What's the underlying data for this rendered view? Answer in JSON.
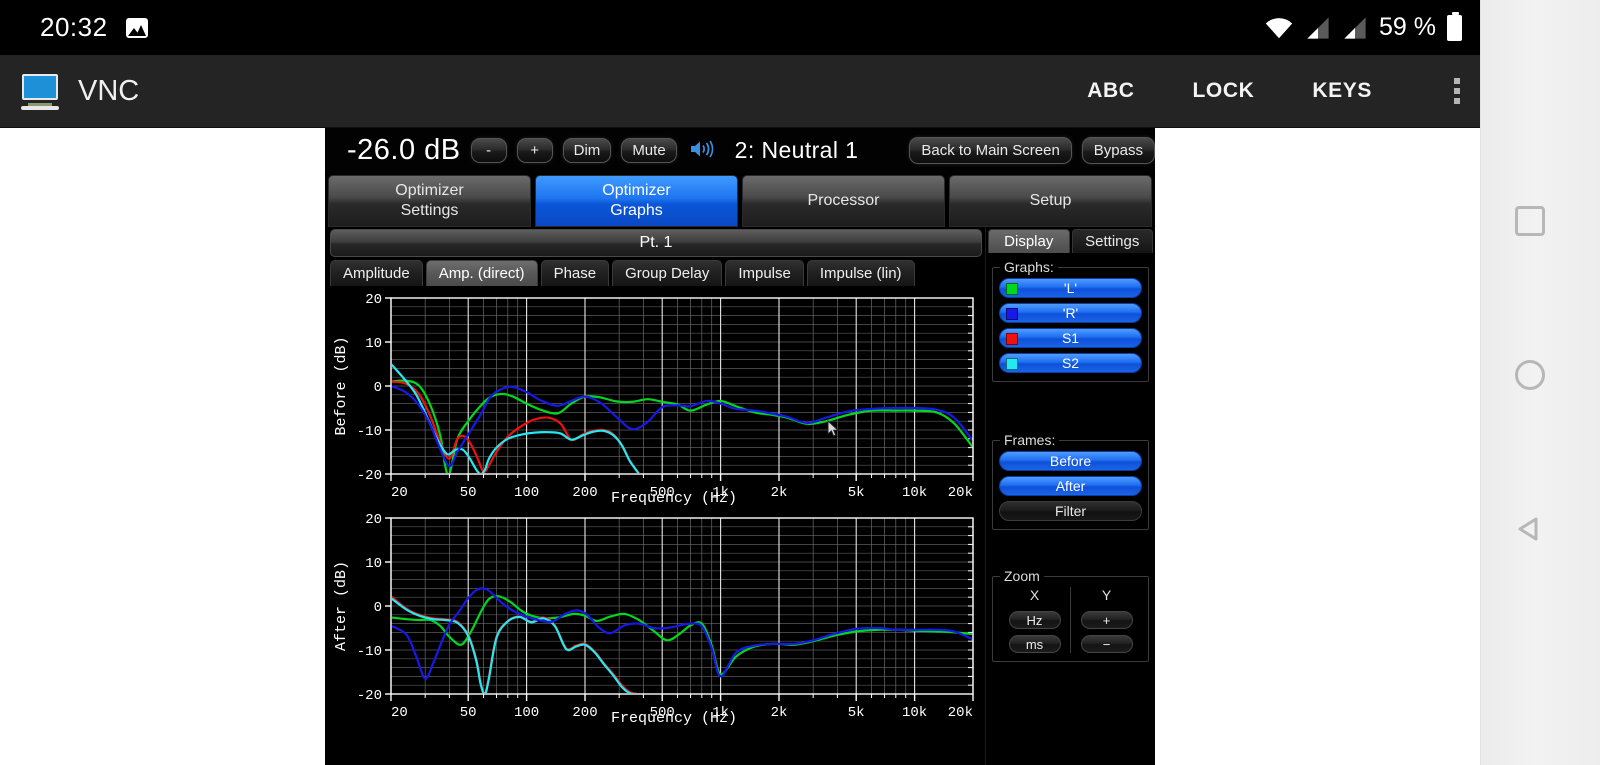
{
  "status_bar": {
    "clock": "20:32",
    "image_icon": "image-icon",
    "wifi_icon": "wifi-icon",
    "signal_icon_1": "signal-bars-icon",
    "signal_icon_2": "signal-bars-icon",
    "battery_percent": "59 %",
    "battery_icon": "battery-icon"
  },
  "vnc_bar": {
    "app_icon": "monitor-icon",
    "title": "VNC",
    "abc": "ABC",
    "lock": "LOCK",
    "keys": "KEYS",
    "overflow_icon": "kebab-menu-icon"
  },
  "nav_rail": {
    "recents_icon": "square-recents-icon",
    "home_icon": "circle-home-icon",
    "back_icon": "triangle-back-icon"
  },
  "app": {
    "top_strip": {
      "db_readout": "-26.0 dB",
      "minus": "-",
      "plus": "+",
      "dim": "Dim",
      "mute": "Mute",
      "speaker_icon": "speaker-volume-icon",
      "preset": "2: Neutral  1",
      "back_to_main": "Back to Main Screen",
      "bypass": "Bypass"
    },
    "main_tabs": [
      {
        "line1": "Optimizer",
        "line2": "Settings",
        "active": false
      },
      {
        "line1": "Optimizer",
        "line2": "Graphs",
        "active": true
      },
      {
        "line1": "Processor",
        "line2": "",
        "active": false
      },
      {
        "line1": "Setup",
        "line2": "",
        "active": false
      }
    ],
    "point_bar": "Pt. 1",
    "sub_tabs": [
      {
        "label": "Amplitude",
        "active": false
      },
      {
        "label": "Amp. (direct)",
        "active": true
      },
      {
        "label": "Phase",
        "active": false
      },
      {
        "label": "Group Delay",
        "active": false
      },
      {
        "label": "Impulse",
        "active": false
      },
      {
        "label": "Impulse (lin)",
        "active": false
      }
    ],
    "right_panel": {
      "tabs": [
        {
          "label": "Display",
          "active": true
        },
        {
          "label": "Settings",
          "active": false
        }
      ],
      "graphs_title": "Graphs:",
      "graphs": [
        {
          "label": "'L'",
          "color": "#00d820",
          "on": true
        },
        {
          "label": "'R'",
          "color": "#1818e8",
          "on": true
        },
        {
          "label": "S1",
          "color": "#ef1010",
          "on": true
        },
        {
          "label": "S2",
          "color": "#25e8f0",
          "on": true
        }
      ],
      "frames_title": "Frames:",
      "frames": [
        {
          "label": "Before",
          "on": true
        },
        {
          "label": "After",
          "on": true
        },
        {
          "label": "Filter",
          "on": false
        }
      ],
      "zoom_title": "Zoom",
      "zoom_x_head": "X",
      "zoom_y_head": "Y",
      "zoom_x_buttons": [
        "Hz",
        "ms"
      ],
      "zoom_y_buttons": [
        "+",
        "−"
      ]
    }
  },
  "chart_data": [
    {
      "type": "line",
      "title": "",
      "xlabel": "Frequency (Hz)",
      "ylabel": "Before (dB)",
      "xscale": "log",
      "xlim": [
        20,
        20000
      ],
      "ylim": [
        -20,
        20
      ],
      "yticks": [
        20,
        10,
        0,
        -10,
        -20
      ],
      "xticks": [
        20,
        50,
        100,
        200,
        500,
        1000,
        2000,
        5000,
        10000,
        20000
      ],
      "xticklabels": [
        "20",
        "50",
        "100",
        "200",
        "500",
        "1k",
        "2k",
        "5k",
        "10k",
        "20k"
      ],
      "grid": true,
      "legend": "external",
      "series": [
        {
          "name": "'L'",
          "color": "#00d820",
          "x": [
            20,
            24,
            28,
            32,
            36,
            38,
            40,
            44,
            50,
            58,
            65,
            75,
            85,
            100,
            120,
            145,
            170,
            200,
            240,
            290,
            350,
            420,
            500,
            600,
            700,
            850,
            1000,
            1200,
            1500,
            1800,
            2200,
            2800,
            3500,
            4500,
            6000,
            8000,
            10000,
            13000,
            16000,
            20000
          ],
          "values": [
            1.0,
            1.2,
            0.0,
            -4.5,
            -11.5,
            -18.0,
            -20.0,
            -12.0,
            -8.0,
            -4.5,
            -2.5,
            -1.8,
            -2.4,
            -4.0,
            -5.5,
            -6.2,
            -4.0,
            -2.4,
            -2.6,
            -3.5,
            -3.6,
            -3.0,
            -3.6,
            -4.2,
            -5.6,
            -4.2,
            -3.4,
            -4.6,
            -6.0,
            -6.5,
            -7.2,
            -8.6,
            -8.0,
            -6.6,
            -5.6,
            -5.6,
            -5.6,
            -6.0,
            -8.5,
            -14.0
          ]
        },
        {
          "name": "'R'",
          "color": "#1818e8",
          "x": [
            20,
            24,
            28,
            32,
            36,
            40,
            44,
            50,
            58,
            65,
            75,
            85,
            100,
            120,
            145,
            170,
            200,
            240,
            290,
            350,
            420,
            500,
            600,
            700,
            850,
            1000,
            1200,
            1500,
            1800,
            2200,
            2800,
            3500,
            4500,
            6000,
            8000,
            10000,
            13000,
            16000,
            20000
          ],
          "values": [
            0.0,
            -1.5,
            -4.5,
            -9.0,
            -14.5,
            -18.2,
            -15.0,
            -11.0,
            -6.5,
            -2.5,
            -0.6,
            -0.2,
            -1.4,
            -3.4,
            -4.5,
            -3.4,
            -2.4,
            -3.8,
            -7.0,
            -9.8,
            -8.2,
            -4.8,
            -4.4,
            -4.6,
            -3.4,
            -4.0,
            -5.2,
            -5.6,
            -6.2,
            -7.0,
            -8.4,
            -7.2,
            -5.8,
            -5.2,
            -5.0,
            -5.0,
            -5.4,
            -7.2,
            -12.5
          ]
        },
        {
          "name": "S1",
          "color": "#ef1010",
          "x": [
            20,
            24,
            28,
            32,
            36,
            40,
            44,
            48,
            52,
            56,
            60,
            64,
            70,
            80,
            95,
            110,
            130,
            150,
            170,
            195,
            220,
            250,
            280,
            310,
            340,
            380
          ],
          "values": [
            1.0,
            0.5,
            -2.0,
            -7.0,
            -13.0,
            -16.5,
            -12.0,
            -11.5,
            -13.5,
            -16.5,
            -19.5,
            -18.0,
            -15.0,
            -11.5,
            -9.0,
            -7.6,
            -7.2,
            -8.6,
            -12.2,
            -11.0,
            -10.2,
            -10.0,
            -11.0,
            -13.5,
            -17.0,
            -20.0
          ]
        },
        {
          "name": "S2",
          "color": "#25e8f0",
          "x": [
            20,
            23,
            27,
            31,
            35,
            39,
            43,
            47,
            51,
            55,
            58,
            61,
            64,
            70,
            80,
            95,
            110,
            130,
            150,
            170,
            195,
            220,
            250,
            280,
            310,
            340,
            380
          ],
          "values": [
            5.0,
            2.0,
            -2.0,
            -7.5,
            -12.5,
            -15.5,
            -14.5,
            -14.5,
            -16.5,
            -19.0,
            -20.0,
            -19.0,
            -16.5,
            -14.0,
            -12.0,
            -11.0,
            -10.6,
            -10.5,
            -10.8,
            -12.2,
            -11.2,
            -10.4,
            -10.2,
            -11.2,
            -13.5,
            -17.0,
            -20.0
          ]
        }
      ]
    },
    {
      "type": "line",
      "title": "",
      "xlabel": "Frequency (Hz)",
      "ylabel": "After (dB)",
      "xscale": "log",
      "xlim": [
        20,
        20000
      ],
      "ylim": [
        -20,
        20
      ],
      "yticks": [
        20,
        10,
        0,
        -10,
        -20
      ],
      "xticks": [
        20,
        50,
        100,
        200,
        500,
        1000,
        2000,
        5000,
        10000,
        20000
      ],
      "xticklabels": [
        "20",
        "50",
        "100",
        "200",
        "500",
        "1k",
        "2k",
        "5k",
        "10k",
        "20k"
      ],
      "grid": true,
      "legend": "external",
      "series": [
        {
          "name": "'L'",
          "color": "#00d820",
          "x": [
            20,
            24,
            28,
            32,
            36,
            40,
            46,
            52,
            58,
            64,
            72,
            82,
            95,
            110,
            130,
            150,
            175,
            200,
            230,
            270,
            320,
            380,
            450,
            530,
            620,
            700,
            800,
            900,
            1000,
            1200,
            1500,
            1900,
            2400,
            3000,
            3800,
            5000,
            6500,
            8000,
            10000,
            13000,
            16000,
            20000
          ],
          "values": [
            -2.6,
            -3.0,
            -3.2,
            -3.2,
            -4.6,
            -7.0,
            -8.8,
            -5.6,
            -1.4,
            1.6,
            2.2,
            1.0,
            -1.2,
            -2.4,
            -2.8,
            -2.5,
            -1.8,
            -2.2,
            -3.4,
            -2.4,
            -1.8,
            -3.2,
            -5.6,
            -7.8,
            -6.2,
            -4.4,
            -4.0,
            -9.0,
            -15.5,
            -11.5,
            -9.2,
            -8.6,
            -8.8,
            -8.0,
            -6.8,
            -5.8,
            -5.4,
            -5.4,
            -5.6,
            -5.8,
            -6.0,
            -6.4
          ]
        },
        {
          "name": "'R'",
          "color": "#1818e8",
          "x": [
            20,
            24,
            27,
            30,
            33,
            36,
            40,
            45,
            50,
            56,
            62,
            68,
            76,
            86,
            100,
            115,
            135,
            155,
            180,
            205,
            235,
            270,
            320,
            380,
            450,
            530,
            620,
            700,
            800,
            900,
            1000,
            1200,
            1500,
            1900,
            2400,
            3000,
            3800,
            5000,
            6500,
            8000,
            10000,
            13000,
            16000,
            20000
          ],
          "values": [
            -4.5,
            -6.5,
            -11.5,
            -16.5,
            -13.0,
            -8.8,
            -4.2,
            -1.2,
            1.8,
            3.8,
            3.8,
            2.4,
            0.4,
            -1.2,
            -2.4,
            -3.2,
            -3.6,
            -2.0,
            -1.0,
            -2.0,
            -4.8,
            -6.2,
            -4.4,
            -4.0,
            -5.0,
            -5.0,
            -4.4,
            -4.0,
            -4.6,
            -9.6,
            -16.0,
            -10.6,
            -9.0,
            -8.6,
            -8.6,
            -7.8,
            -6.4,
            -5.2,
            -5.0,
            -5.4,
            -5.4,
            -5.4,
            -5.8,
            -7.6
          ]
        },
        {
          "name": "S1",
          "color": "#ef1010",
          "x": [
            20,
            24,
            28,
            33,
            38,
            44,
            50,
            55,
            58,
            61,
            64,
            70,
            80,
            92,
            106,
            122,
            140,
            160,
            180,
            200,
            225,
            250,
            280,
            310,
            340,
            370
          ],
          "values": [
            2.2,
            -0.6,
            -2.0,
            -2.8,
            -3.0,
            -3.6,
            -6.6,
            -12.0,
            -17.5,
            -20.0,
            -16.0,
            -7.0,
            -3.4,
            -2.4,
            -3.6,
            -2.6,
            -4.4,
            -9.6,
            -9.0,
            -8.6,
            -10.4,
            -13.0,
            -15.5,
            -18.0,
            -19.6,
            -20.0
          ]
        },
        {
          "name": "S2",
          "color": "#25e8f0",
          "x": [
            20,
            24,
            28,
            33,
            38,
            44,
            50,
            55,
            58,
            61,
            64,
            70,
            80,
            92,
            106,
            122,
            140,
            160,
            180,
            200,
            225,
            250,
            280,
            310,
            340,
            370
          ],
          "values": [
            1.8,
            -0.8,
            -2.2,
            -3.0,
            -3.2,
            -3.8,
            -6.8,
            -12.4,
            -17.8,
            -20.0,
            -16.4,
            -7.2,
            -3.5,
            -2.5,
            -3.7,
            -2.8,
            -4.6,
            -9.8,
            -9.2,
            -8.8,
            -10.6,
            -13.2,
            -15.8,
            -18.4,
            -19.8,
            -20.0
          ]
        }
      ]
    }
  ]
}
